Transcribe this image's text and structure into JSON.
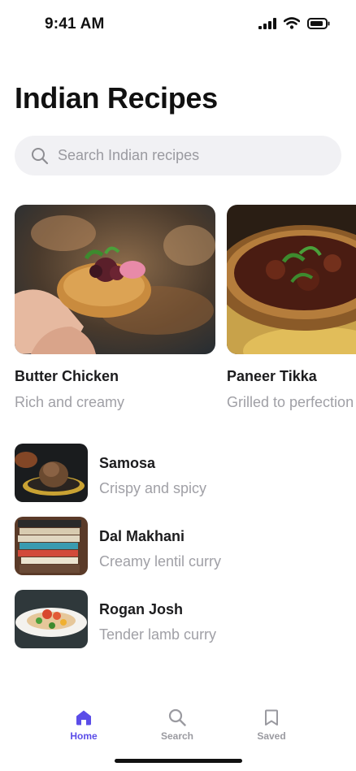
{
  "status_bar": {
    "time": "9:41 AM"
  },
  "page": {
    "title": "Indian Recipes"
  },
  "search": {
    "placeholder": "Search Indian recipes",
    "value": ""
  },
  "featured": [
    {
      "title": "Butter Chicken",
      "subtitle": "Rich and creamy"
    },
    {
      "title": "Paneer Tikka",
      "subtitle": "Grilled to perfection"
    }
  ],
  "recipes": [
    {
      "title": "Samosa",
      "subtitle": "Crispy and spicy"
    },
    {
      "title": "Dal Makhani",
      "subtitle": "Creamy lentil curry"
    },
    {
      "title": "Rogan Josh",
      "subtitle": "Tender lamb curry"
    }
  ],
  "tabs": [
    {
      "label": "Home",
      "icon": "home-icon",
      "active": true
    },
    {
      "label": "Search",
      "icon": "search-icon",
      "active": false
    },
    {
      "label": "Saved",
      "icon": "bookmark-icon",
      "active": false
    }
  ],
  "colors": {
    "accent": "#5b4de8",
    "muted": "#9a9aa0",
    "search_bg": "#f1f1f4"
  }
}
